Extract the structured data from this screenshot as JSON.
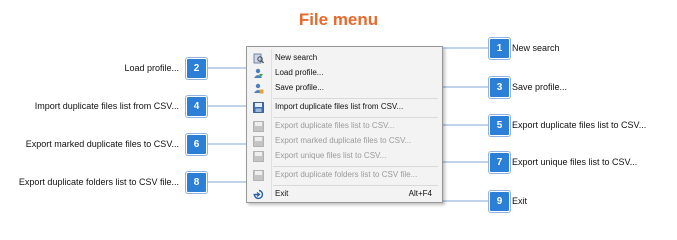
{
  "title": "File menu",
  "menu": {
    "items": [
      {
        "label": "New search",
        "enabled": true,
        "icon": "search-icon"
      },
      {
        "label": "Load profile...",
        "enabled": true,
        "icon": "load-profile-icon"
      },
      {
        "label": "Save profile...",
        "enabled": true,
        "icon": "save-profile-icon"
      },
      {
        "label": "Import duplicate files list from CSV...",
        "enabled": true,
        "icon": "import-csv-icon"
      },
      {
        "label": "Export duplicate files list to CSV...",
        "enabled": false,
        "icon": "export-csv-icon"
      },
      {
        "label": "Export marked duplicate files to CSV...",
        "enabled": false,
        "icon": "export-csv-icon"
      },
      {
        "label": "Export unique files list to CSV...",
        "enabled": false,
        "icon": "export-csv-icon"
      },
      {
        "label": "Export duplicate folders list to CSV file...",
        "enabled": false,
        "icon": "export-csv-icon"
      },
      {
        "label": "Exit",
        "shortcut": "Alt+F4",
        "enabled": true,
        "icon": "exit-icon"
      }
    ]
  },
  "callouts": [
    {
      "num": "1",
      "label": "New search"
    },
    {
      "num": "2",
      "label": "Load profile..."
    },
    {
      "num": "3",
      "label": "Save profile..."
    },
    {
      "num": "4",
      "label": "Import duplicate files list from CSV..."
    },
    {
      "num": "5",
      "label": "Export duplicate files list to CSV..."
    },
    {
      "num": "6",
      "label": "Export marked duplicate files to CSV..."
    },
    {
      "num": "7",
      "label": "Export unique files list to CSV..."
    },
    {
      "num": "8",
      "label": "Export duplicate folders list to CSV file..."
    },
    {
      "num": "9",
      "label": "Exit"
    }
  ],
  "colors": {
    "title": "#e8692a",
    "callout": "#2b7fd6",
    "line": "#7fa7d9",
    "disabled_text": "#9a9a9a"
  }
}
